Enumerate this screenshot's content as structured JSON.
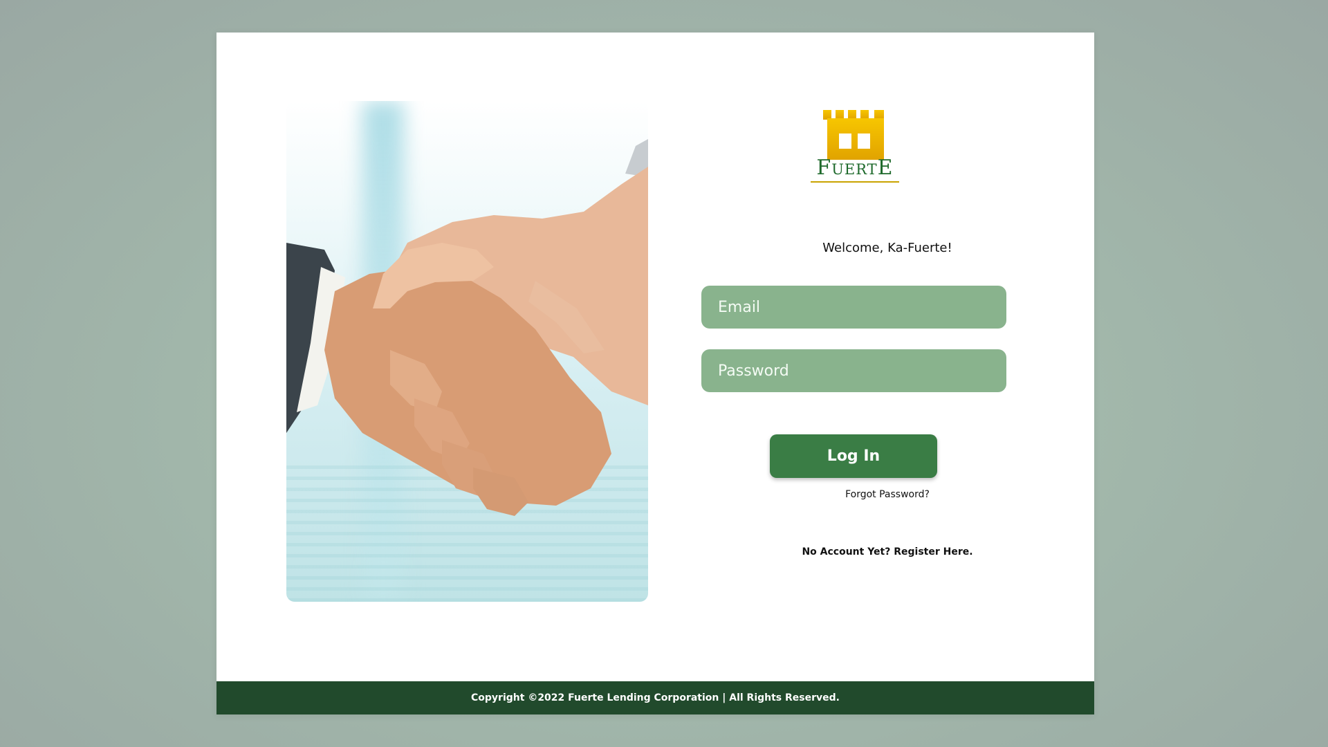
{
  "brand": {
    "logo_text": "FuertE",
    "colors": {
      "primary": "#3a7d45",
      "field": "#89b38d",
      "footer": "#214a2c",
      "gold": "#f2c200"
    }
  },
  "login": {
    "welcome": "Welcome, Ka-Fuerte!",
    "email_placeholder": "Email",
    "password_placeholder": "Password",
    "login_label": "Log In",
    "forgot_label": "Forgot Password?",
    "register_label": "No Account Yet? Register Here."
  },
  "footer": {
    "copyright": "Copyright  ©2022  Fuerte Lending Corporation | All Rights Reserved."
  },
  "icons": {
    "logo": "castle-tower-icon",
    "hero": "handshake-image"
  }
}
